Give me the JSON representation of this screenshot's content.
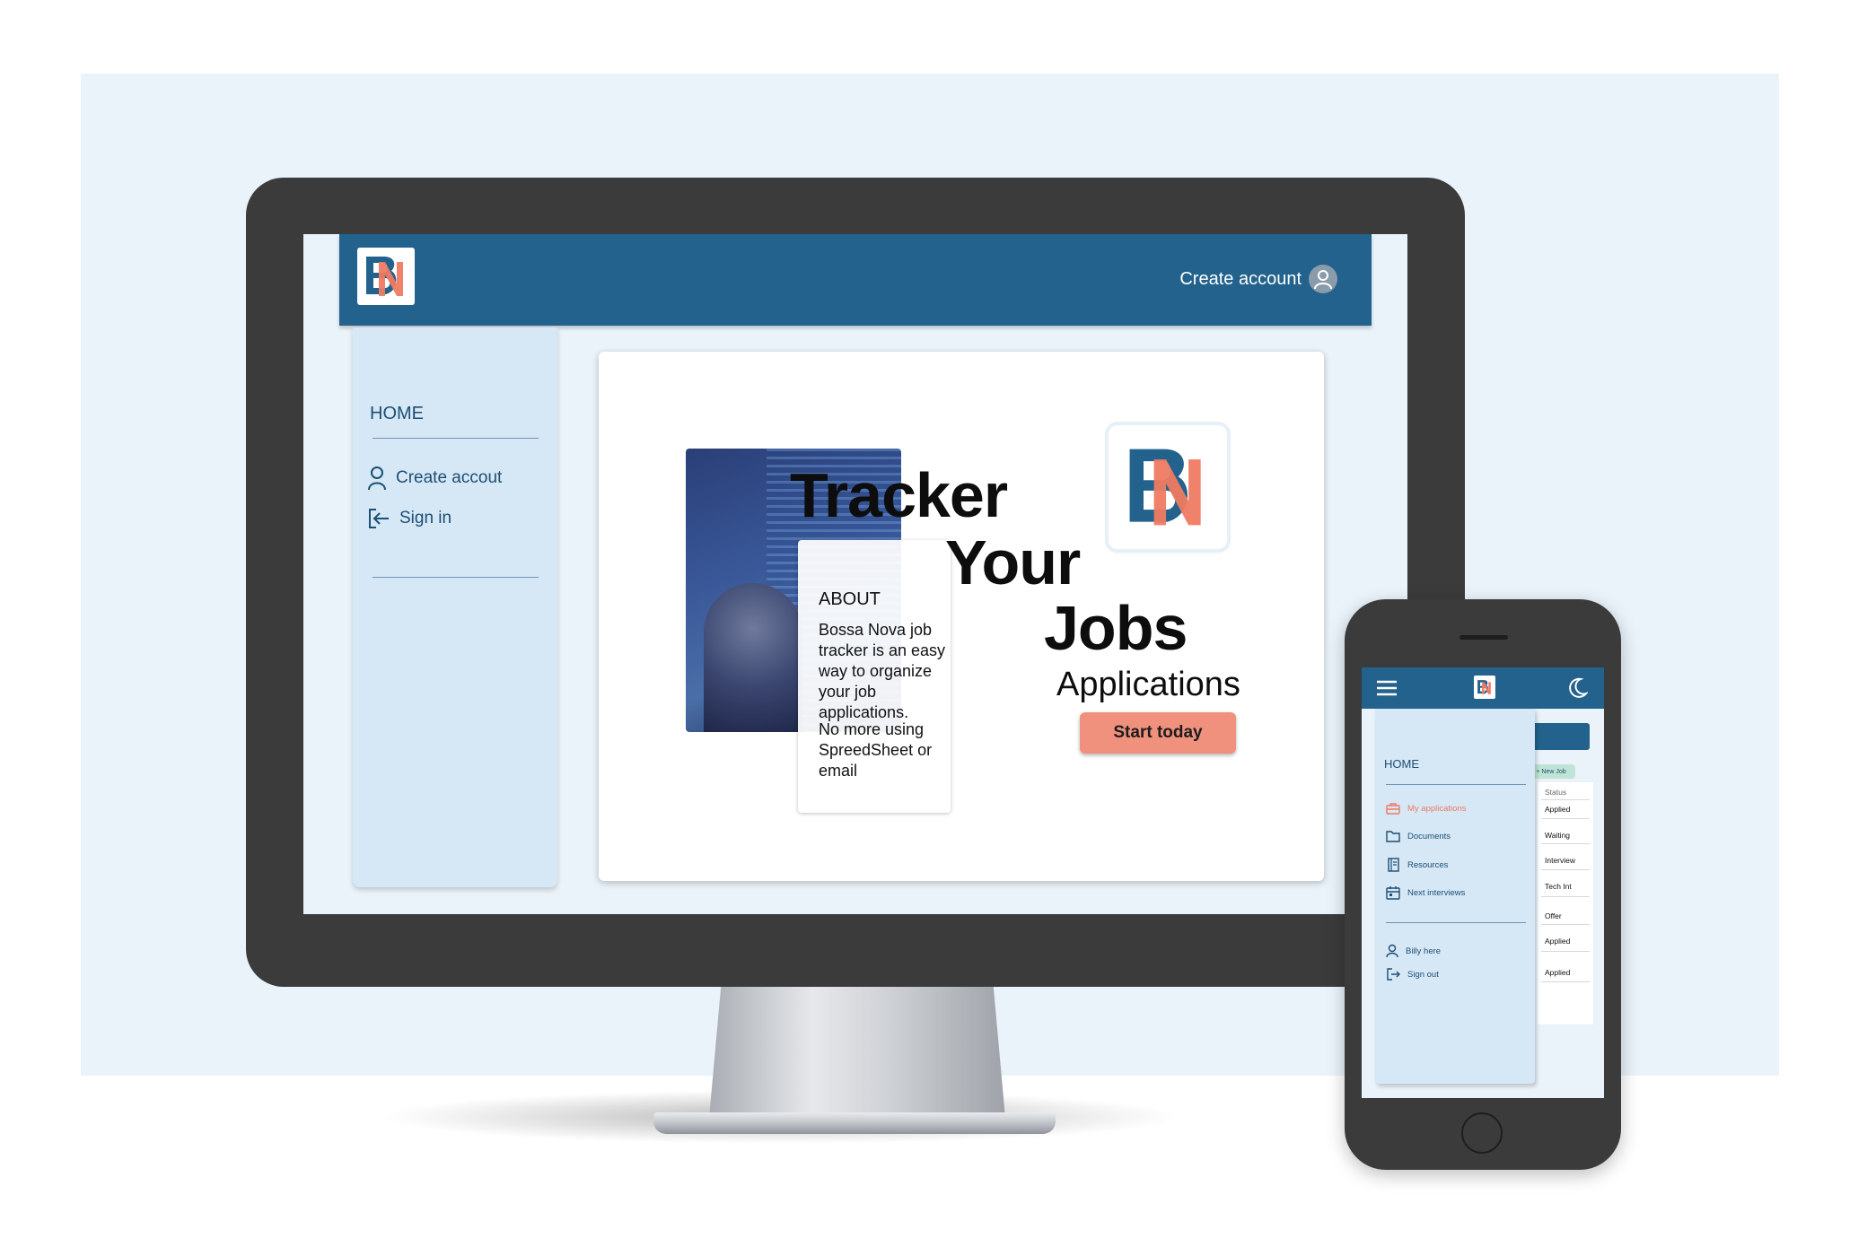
{
  "desktop": {
    "header": {
      "logo_letters": "BN",
      "create_account_label": "Create account"
    },
    "sidebar": {
      "home_label": "HOME",
      "items": [
        {
          "label": "Create accout",
          "icon": "user-icon"
        },
        {
          "label": "Sign in",
          "icon": "sign-in-icon"
        }
      ]
    },
    "hero": {
      "line1": "Tracker",
      "line2": "Your",
      "line3": "Jobs",
      "subtitle": "Applications",
      "cta_label": "Start today"
    },
    "about": {
      "title": "ABOUT",
      "body": "Bossa Nova job tracker is an easy way to organize your job applications.",
      "body2": "No more using SpreedSheet or email"
    }
  },
  "mobile": {
    "home_label": "HOME",
    "nav_items": [
      {
        "label": "My applications",
        "icon": "briefcase-icon",
        "active": true
      },
      {
        "label": "Documents",
        "icon": "folder-icon",
        "active": false
      },
      {
        "label": "Resources",
        "icon": "book-icon",
        "active": false
      },
      {
        "label": "Next interviews",
        "icon": "calendar-icon",
        "active": false
      }
    ],
    "account_items": [
      {
        "label": "Billy here",
        "icon": "user-icon"
      },
      {
        "label": "Sign out",
        "icon": "sign-out-icon"
      }
    ],
    "new_job_label": "+ New Job",
    "table": {
      "header": "Status",
      "rows": [
        "Applied",
        "Waiting",
        "Interview",
        "Tech Int",
        "Offer",
        "Applied",
        "Applied"
      ]
    }
  },
  "colors": {
    "brand_blue": "#22628c",
    "sidebar_blue": "#d6e7f6",
    "accent_coral": "#f0917d",
    "background": "#eaf3fa"
  }
}
